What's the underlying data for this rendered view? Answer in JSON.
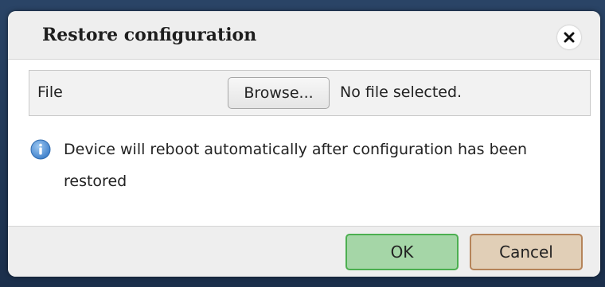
{
  "dialog": {
    "title": "Restore configuration",
    "close_icon": "close-icon"
  },
  "file_row": {
    "label": "File",
    "browse_label": "Browse...",
    "status": "No file selected."
  },
  "info": {
    "icon": "info-icon",
    "message": "Device will reboot automatically after configuration has been restored"
  },
  "footer": {
    "ok_label": "OK",
    "cancel_label": "Cancel"
  },
  "colors": {
    "ok_bg": "#a5d6a7",
    "ok_border": "#4caf50",
    "cancel_bg": "#e1cfb7",
    "cancel_border": "#b5845a",
    "info_icon": "#4a8fd6"
  }
}
